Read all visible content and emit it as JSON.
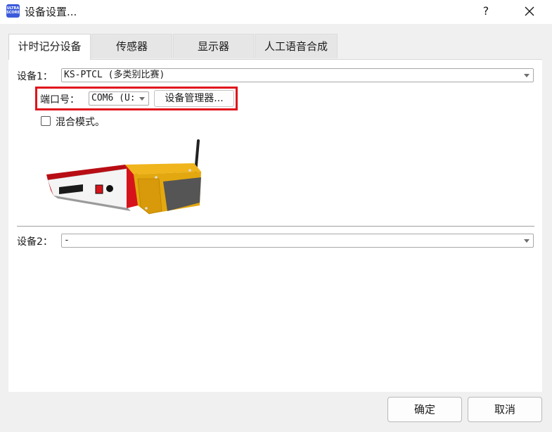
{
  "window": {
    "title": "设备设置...",
    "app_icon_text": [
      "ULTRA",
      "SCORE"
    ],
    "help_label": "?",
    "close_icon": "close-icon"
  },
  "tabs": [
    {
      "label": "计时记分设备",
      "active": true
    },
    {
      "label": "传感器",
      "active": false
    },
    {
      "label": "显示器",
      "active": false
    },
    {
      "label": "人工语音合成",
      "active": false
    }
  ],
  "device1": {
    "label": "设备1：",
    "value": "KS-PTCL (多类别比赛)"
  },
  "port": {
    "label": "端口号：",
    "value": "COM6 (U:",
    "manager_button": "设备管理器..."
  },
  "mixed_mode": {
    "label": "混合模式。",
    "checked": false
  },
  "device2": {
    "label": "设备2：",
    "value": "-"
  },
  "footer": {
    "ok": "确定",
    "cancel": "取消"
  },
  "colors": {
    "highlight": "#e0141c",
    "device_red": "#d6131b",
    "device_yellow": "#e3a80f"
  }
}
